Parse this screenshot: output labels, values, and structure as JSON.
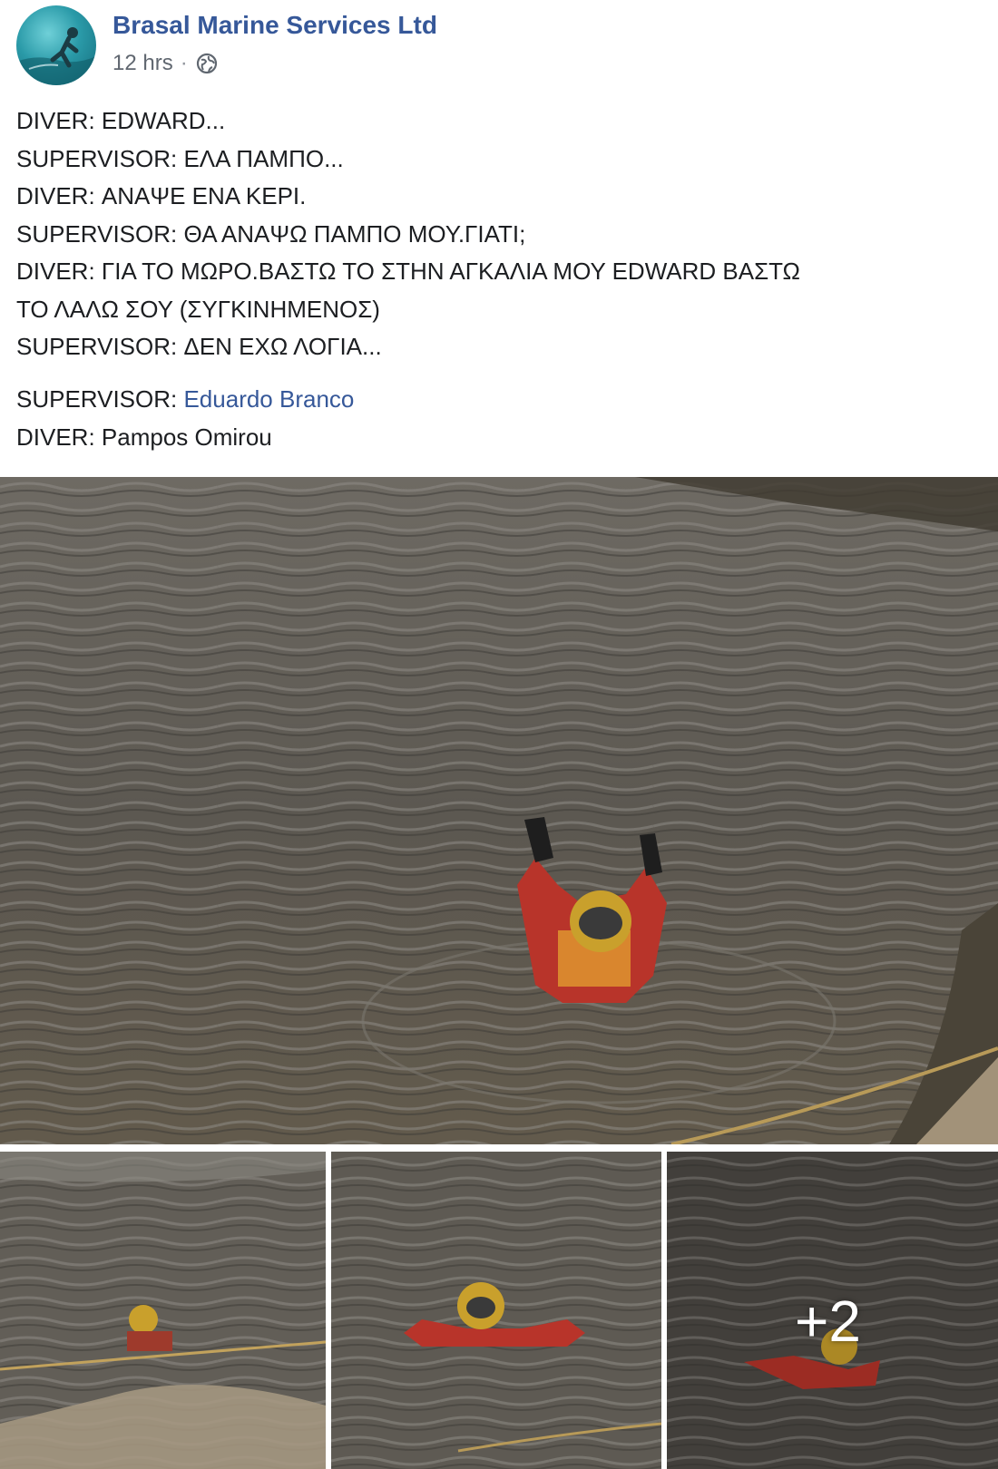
{
  "post": {
    "author": "Brasal Marine Services Ltd",
    "timestamp": "12 hrs",
    "separator": "·",
    "privacy_icon": "globe-icon",
    "lines": [
      "DIVER: EDWARD...",
      "SUPERVISOR: ΕΛΑ ΠΑΜΠΟ...",
      "DIVER: ΑΝΑΨΕ ΕΝΑ ΚΕΡΙ.",
      "SUPERVISOR: ΘΑ ΑΝΑΨΩ ΠΑΜΠΟ ΜΟΥ.ΓΙΑΤΙ;",
      "DIVER: ΓΙΑ ΤΟ ΜΩΡΟ.ΒΑΣΤΩ ΤΟ ΣΤΗΝ ΑΓΚΑΛΙΑ ΜΟΥ EDWARD ΒΑΣΤΩ",
      "ΤΟ ΛΑΛΩ ΣΟΥ (ΣΥΓΚΙΝΗΜΕΝΟΣ)",
      "SUPERVISOR: ΔΕΝ ΕΧΩ ΛΟΓΙΑ..."
    ],
    "credits": {
      "supervisor_label": "SUPERVISOR: ",
      "supervisor_name": "Eduardo Branco",
      "diver_label": "DIVER: ",
      "diver_name": "Pampos Omirou"
    }
  },
  "photos": {
    "more_count": "+2"
  },
  "colors": {
    "link": "#365899",
    "text": "#1c1e21",
    "meta": "#606770",
    "water": "#5f5a52",
    "drysuit": "#b8342a"
  }
}
